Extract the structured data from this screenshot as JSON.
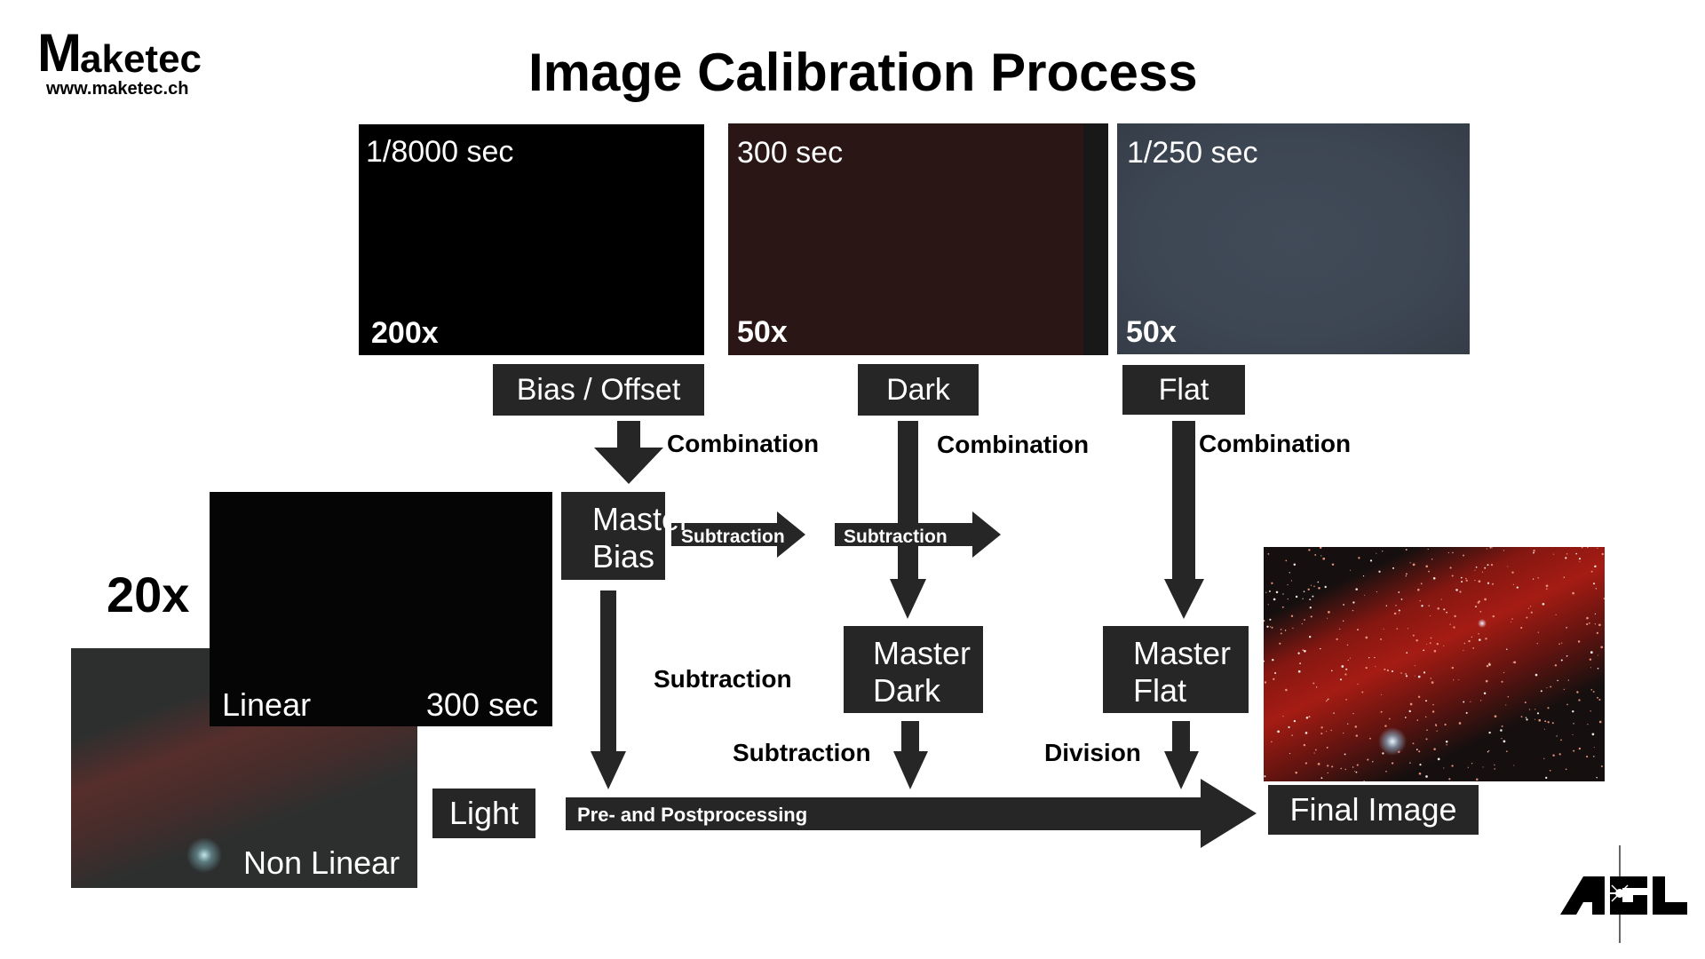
{
  "brand": {
    "name_initial": "M",
    "name_rest": "aketec",
    "url": "www.maketec.ch"
  },
  "title": "Image Calibration Process",
  "frames": {
    "bias": {
      "exposure": "1/8000 sec",
      "count": "200x",
      "label": "Bias / Offset",
      "color": "#000000"
    },
    "dark": {
      "exposure": "300 sec",
      "count": "50x",
      "label": "Dark",
      "color": "#2a1615"
    },
    "flat": {
      "exposure": "1/250 sec",
      "count": "50x",
      "label": "Flat",
      "color": "#3d4653"
    }
  },
  "light": {
    "count": "20x",
    "linear_label": "Linear",
    "linear_exposure": "300 sec",
    "nonlinear_label": "Non Linear",
    "label": "Light"
  },
  "masters": {
    "bias": [
      "Master",
      "Bias"
    ],
    "dark": [
      "Master",
      "Dark"
    ],
    "flat": [
      "Master",
      "Flat"
    ]
  },
  "operations": {
    "combination_bias": "Combination",
    "combination_dark": "Combination",
    "combination_flat": "Combination",
    "bias_to_dark": "Subtraction",
    "dark_to_flat": "Subtraction",
    "bias_to_light": "Subtraction",
    "dark_to_light": "Subtraction",
    "flat_to_light": "Division",
    "pipeline": "Pre- and Postprocessing"
  },
  "final_label": "Final Image",
  "partner_logo": "AGL",
  "colors": {
    "box": "#262626",
    "nebula": "#b01c14"
  }
}
